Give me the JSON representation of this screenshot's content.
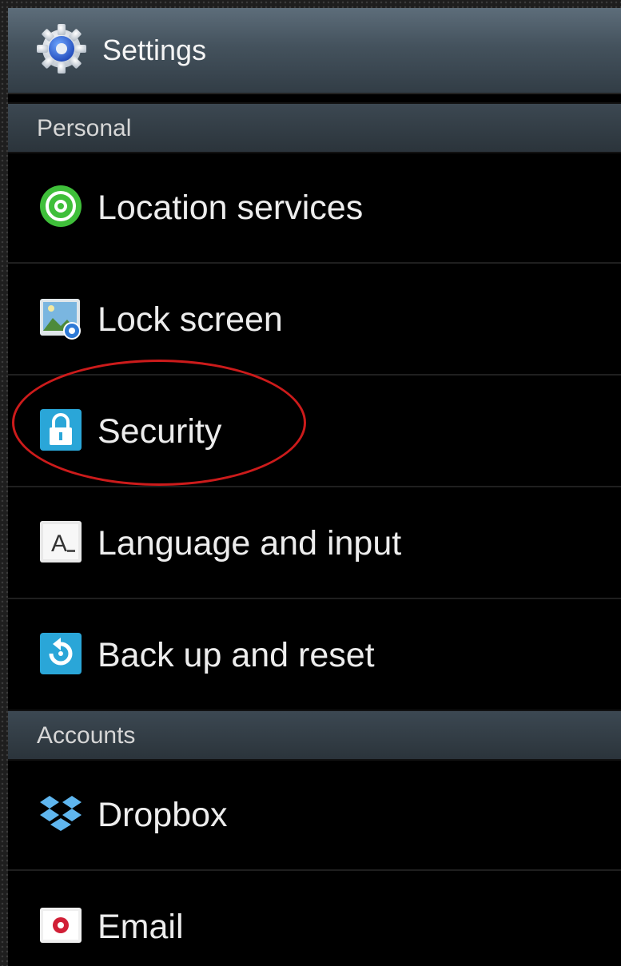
{
  "header": {
    "title": "Settings",
    "icon": "gear-icon"
  },
  "sections": [
    {
      "header": "Personal",
      "items": [
        {
          "label": "Location services",
          "icon": "location-icon"
        },
        {
          "label": "Lock screen",
          "icon": "lock-screen-icon"
        },
        {
          "label": "Security",
          "icon": "padlock-icon",
          "highlighted": true
        },
        {
          "label": "Language and input",
          "icon": "keyboard-letter-icon"
        },
        {
          "label": "Back up and reset",
          "icon": "backup-reset-icon"
        }
      ]
    },
    {
      "header": "Accounts",
      "items": [
        {
          "label": "Dropbox",
          "icon": "dropbox-icon"
        },
        {
          "label": "Email",
          "icon": "email-icon"
        }
      ]
    }
  ],
  "colors": {
    "background": "#000000",
    "highlight_ring": "#cc1b1b",
    "text": "#ededed"
  }
}
